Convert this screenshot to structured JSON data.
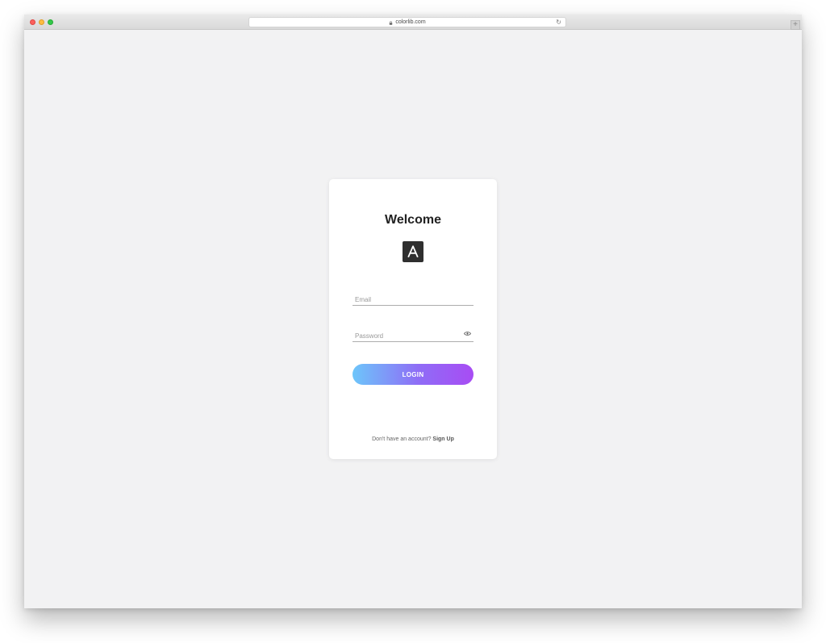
{
  "browser": {
    "url": "colorlib.com"
  },
  "login_card": {
    "title": "Welcome",
    "logo_letter": "A",
    "email_placeholder": "Email",
    "password_placeholder": "Password",
    "login_label": "LOGIN",
    "signup_prompt": "Don't have an account?",
    "signup_link": "Sign Up"
  },
  "colors": {
    "page_background": "#f2f2f3",
    "card_background": "#ffffff",
    "button_gradient_start": "#6dc6fa",
    "button_gradient_end": "#a84cf4",
    "logo_background": "#2f2f2f"
  },
  "icons": {
    "lock": "lock-icon",
    "reload": "reload-icon",
    "new_tab": "plus-icon",
    "show_password": "eye-icon"
  }
}
